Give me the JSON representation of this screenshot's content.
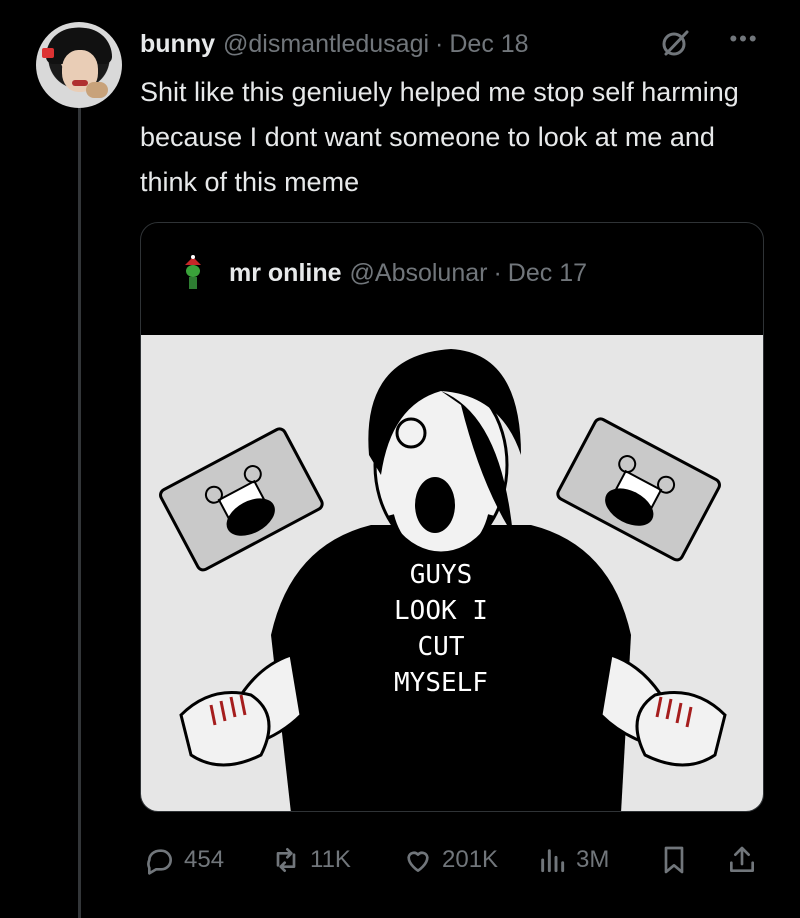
{
  "post": {
    "author_name": "bunny",
    "author_handle": "@dismantledusagi",
    "separator": "·",
    "date": "Dec 18",
    "text": "Shit like this geniuely helped me stop self harming because I dont want someone to look at me and think of this meme"
  },
  "quoted_post": {
    "author_name": "mr online",
    "author_handle": "@Absolunar",
    "separator": "·",
    "date": "Dec 17",
    "meme_text": [
      "GUYS",
      "LOOK I",
      "CUT",
      "MYSELF"
    ]
  },
  "actions": {
    "replies": "454",
    "reposts": "11K",
    "likes": "201K",
    "views": "3M"
  },
  "icons": {
    "reply": "reply-icon",
    "repost": "repost-icon",
    "like": "heart-icon",
    "views": "views-icon",
    "bookmark": "bookmark-icon",
    "share": "share-icon",
    "more": "more-icon",
    "grok": "grok-icon"
  },
  "colors": {
    "background": "#000000",
    "text_primary": "#e7e9ea",
    "text_secondary": "#71767b",
    "border": "#2f3336"
  }
}
